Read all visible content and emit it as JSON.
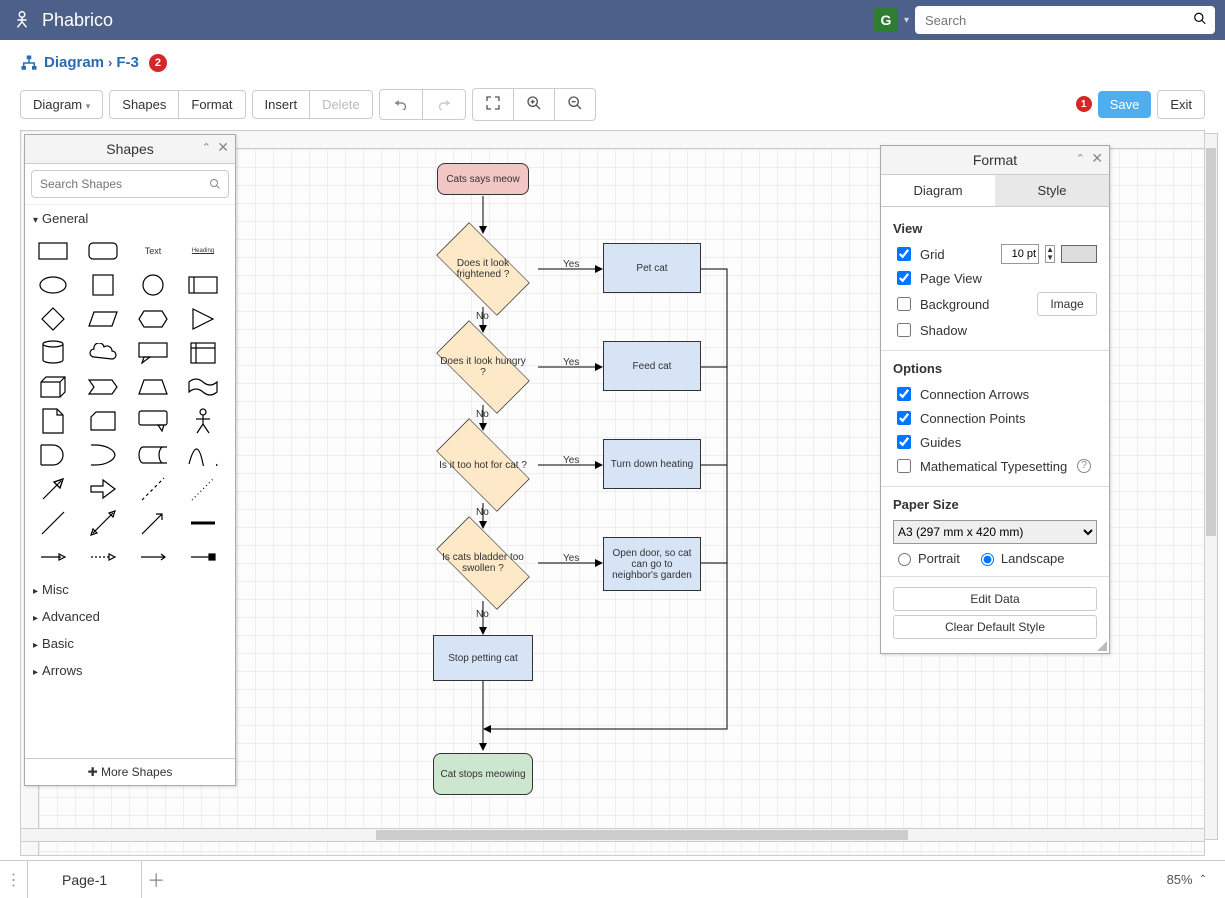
{
  "app": {
    "name": "Phabrico",
    "avatar_letter": "G",
    "search_placeholder": "Search"
  },
  "breadcrumb": {
    "root": "Diagram",
    "leaf": "F-3",
    "badge": "2"
  },
  "toolbar": {
    "menu_diagram": "Diagram",
    "menu_shapes": "Shapes",
    "menu_format": "Format",
    "menu_insert": "Insert",
    "menu_delete": "Delete",
    "save": "Save",
    "save_badge": "1",
    "exit": "Exit"
  },
  "shapes_panel": {
    "title": "Shapes",
    "search_placeholder": "Search Shapes",
    "sections": {
      "general": "General",
      "misc": "Misc",
      "advanced": "Advanced",
      "basic": "Basic",
      "arrows": "Arrows"
    },
    "text_label": "Text",
    "heading_label": "Heading",
    "more": "More Shapes"
  },
  "flow": {
    "start": "Cats says meow",
    "d1": "Does it look frightened ?",
    "d2": "Does it look hungry ?",
    "d3": "Is it too hot for cat ?",
    "d4": "Is cats bladder too swollen ?",
    "a1": "Pet cat",
    "a2": "Feed cat",
    "a3": "Turn down heating",
    "a4": "Open door, so cat can go to neighbor's garden",
    "stop1": "Stop petting cat",
    "end": "Cat stops meowing",
    "yes": "Yes",
    "no": "No"
  },
  "format_panel": {
    "title": "Format",
    "tab_diagram": "Diagram",
    "tab_style": "Style",
    "section_view": "View",
    "grid": "Grid",
    "grid_value": "10 pt",
    "page_view": "Page View",
    "background": "Background",
    "image_btn": "Image",
    "shadow": "Shadow",
    "section_options": "Options",
    "conn_arrows": "Connection Arrows",
    "conn_points": "Connection Points",
    "guides": "Guides",
    "math": "Mathematical Typesetting",
    "section_paper": "Paper Size",
    "paper_value": "A3 (297 mm x 420 mm)",
    "portrait": "Portrait",
    "landscape": "Landscape",
    "edit_data": "Edit Data",
    "clear_style": "Clear Default Style"
  },
  "bottom": {
    "page_tab": "Page-1",
    "zoom": "85%"
  }
}
